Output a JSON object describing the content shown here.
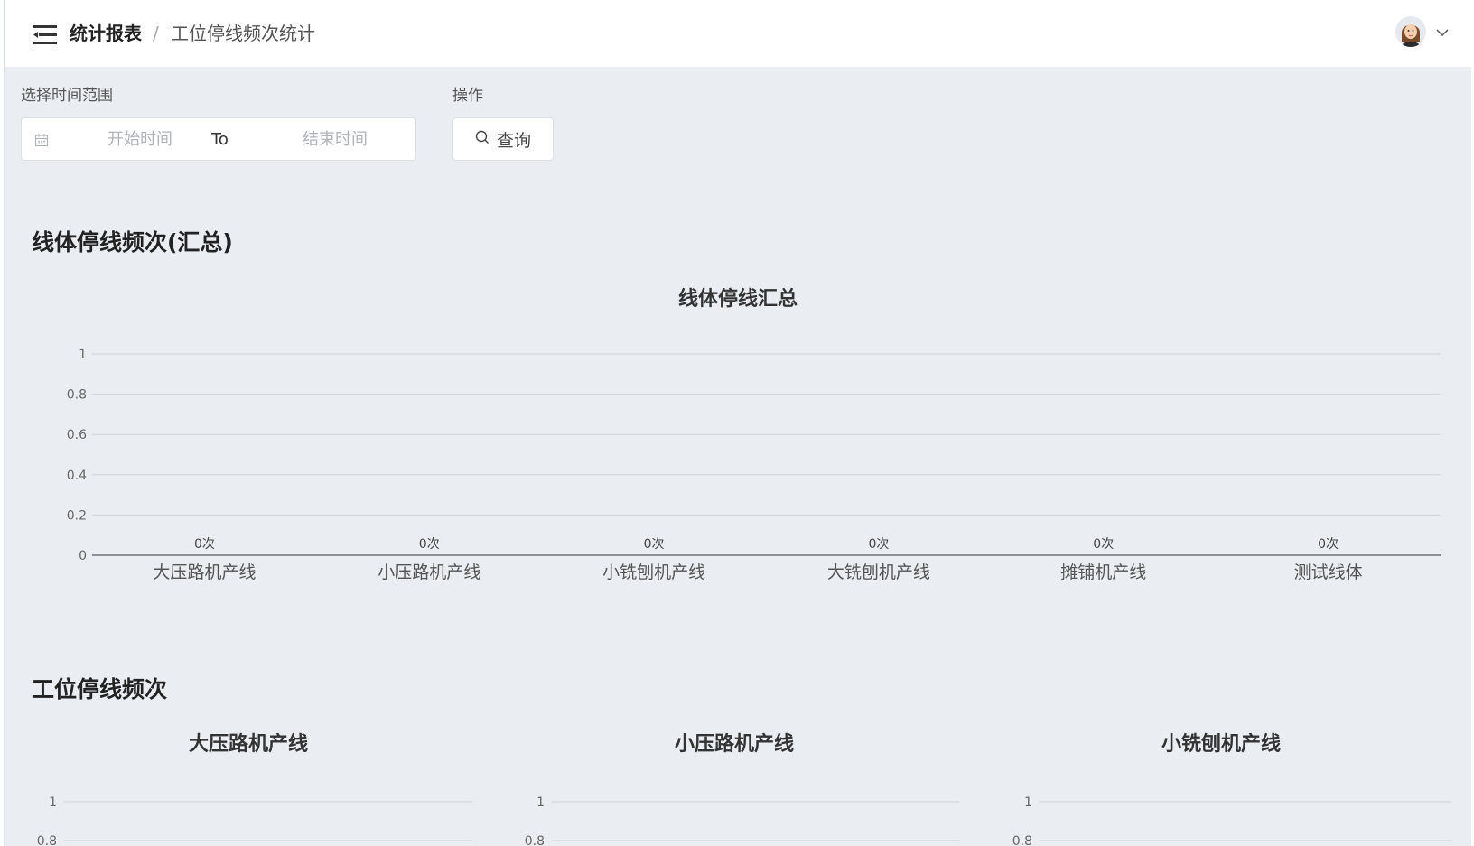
{
  "header": {
    "breadcrumb_root": "统计报表",
    "breadcrumb_sep": "/",
    "breadcrumb_page": "工位停线频次统计"
  },
  "filters": {
    "range_label": "选择时间范围",
    "start_placeholder": "开始时间",
    "to_label": "To",
    "end_placeholder": "结束时间",
    "action_label": "操作",
    "query_label": "查询"
  },
  "summary": {
    "section_title": "线体停线频次(汇总)",
    "chart_title": "线体停线汇总"
  },
  "station": {
    "section_title": "工位停线频次",
    "chart_titles": [
      "大压路机产线",
      "小压路机产线",
      "小铣刨机产线"
    ]
  },
  "colors": {
    "accent_text": "#222222",
    "grid": "#cfd3d8",
    "axis": "#666666",
    "bg": "#eaeef2"
  },
  "chart_data": [
    {
      "type": "bar",
      "title": "线体停线汇总",
      "categories": [
        "大压路机产线",
        "小压路机产线",
        "小铣刨机产线",
        "大铣刨机产线",
        "摊铺机产线",
        "测试线体"
      ],
      "values": [
        0,
        0,
        0,
        0,
        0,
        0
      ],
      "data_labels": [
        "0次",
        "0次",
        "0次",
        "0次",
        "0次",
        "0次"
      ],
      "ylim": [
        0,
        1
      ],
      "yticks": [
        "0",
        "0.2",
        "0.4",
        "0.6",
        "0.8",
        "1"
      ],
      "grid": true
    },
    {
      "type": "bar",
      "title": "大压路机产线",
      "ylim": [
        0,
        1
      ],
      "yticks_visible": [
        "1",
        "0.8"
      ],
      "grid": true
    },
    {
      "type": "bar",
      "title": "小压路机产线",
      "ylim": [
        0,
        1
      ],
      "yticks_visible": [
        "1",
        "0.8"
      ],
      "grid": true
    },
    {
      "type": "bar",
      "title": "小铣刨机产线",
      "ylim": [
        0,
        1
      ],
      "yticks_visible": [
        "1",
        "0.8"
      ],
      "grid": true
    }
  ]
}
